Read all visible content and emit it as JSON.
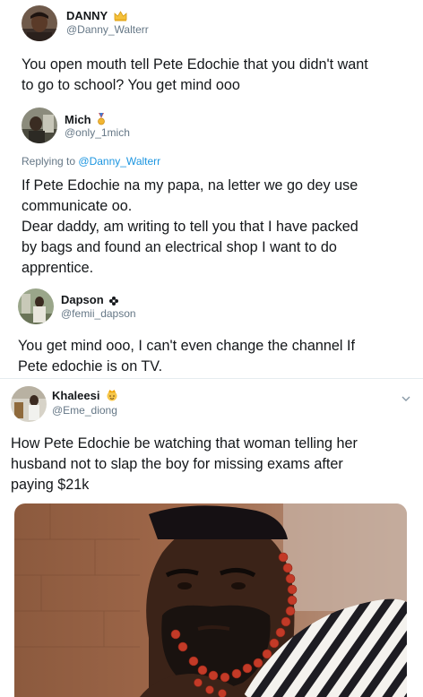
{
  "tweets": [
    {
      "display_name": "DANNY",
      "badge": "crown-emoji",
      "handle": "@Danny_Walterr",
      "text_lines": [
        "You open mouth tell Pete Edochie that you didn't want",
        "to go to school? You get mind ooo"
      ]
    },
    {
      "display_name": "Mich",
      "badge": "medal-emoji",
      "handle": "@only_1mich",
      "replying_prefix": "Replying to",
      "replying_to": "@Danny_Walterr",
      "text_lines": [
        "If Pete Edochie na my papa, na letter we go dey use",
        "communicate oo.",
        "Dear daddy, am writing to tell you that I have packed",
        "by bags and found an electrical shop I want to do",
        "apprentice."
      ]
    },
    {
      "display_name": "Dapson",
      "badge": "flower-icon",
      "handle": "@femii_dapson",
      "text_lines": [
        "You get mind ooo, I can't even change the channel If",
        "Pete edochie is on TV."
      ]
    },
    {
      "display_name": "Khaleesi",
      "badge": "princess-emoji",
      "handle": "@Eme_diong",
      "text_lines": [
        "How Pete Edochie be watching that woman telling her",
        "husband not to slap the boy for missing exams after",
        "paying $21k"
      ],
      "media": "photo-of-stern-man-in-striped-outfit-with-coral-beads"
    }
  ],
  "colors": {
    "text": "#14171a",
    "secondary": "#657786",
    "link": "#1b95e0",
    "divider": "#e6ecf0"
  }
}
